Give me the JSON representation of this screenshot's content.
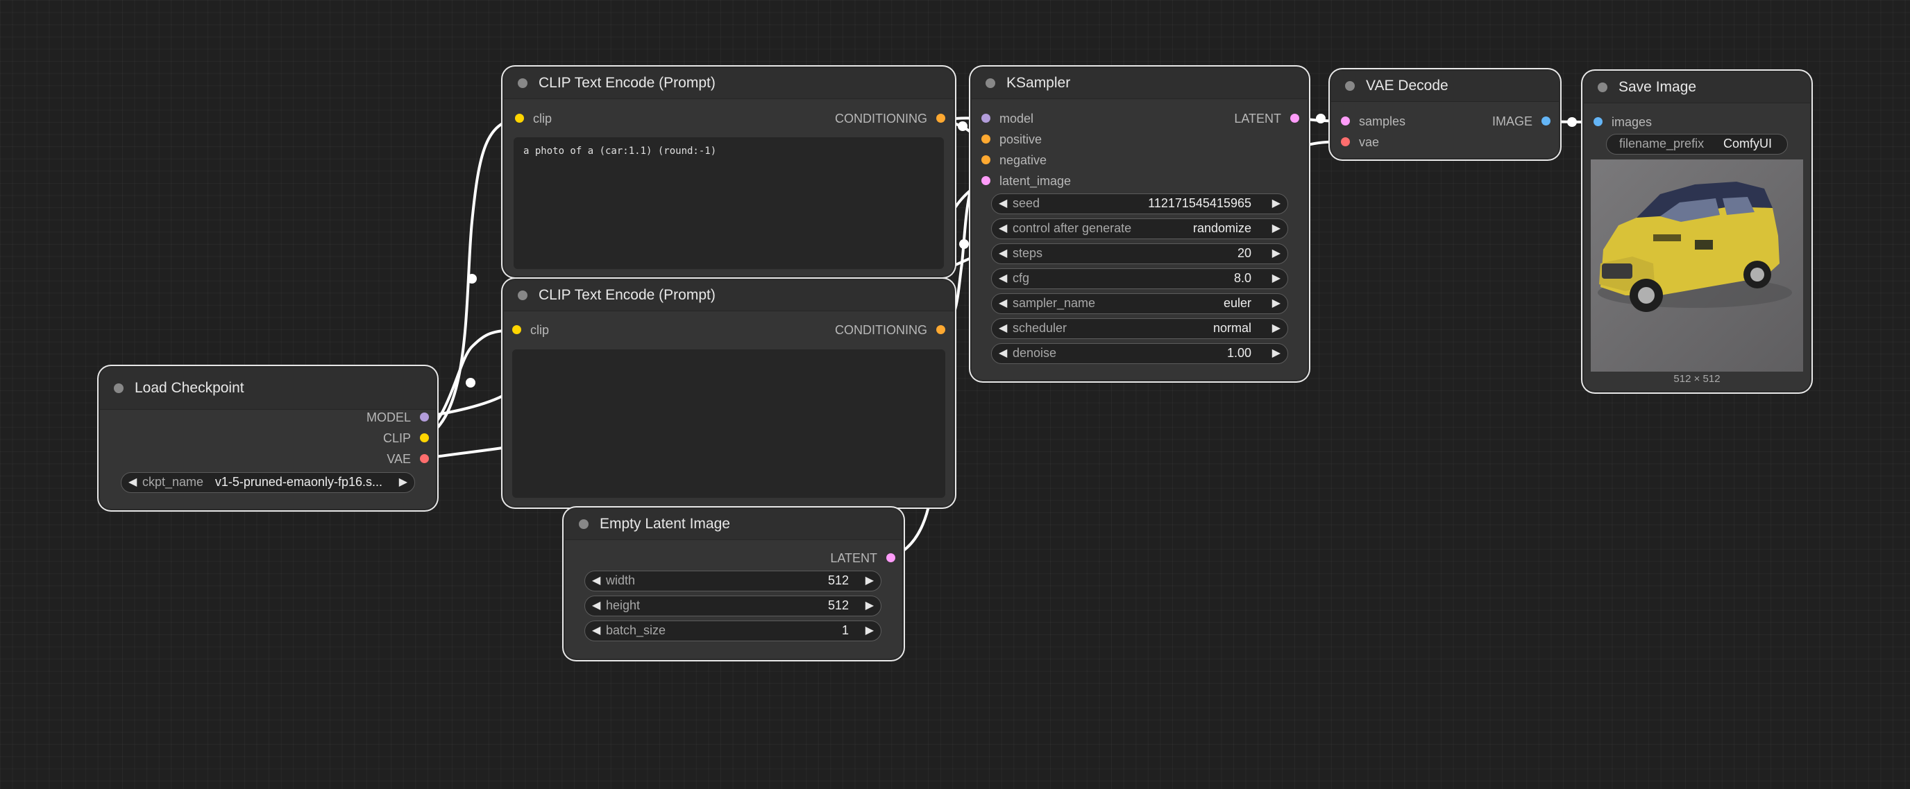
{
  "nodes": {
    "clip_text_encode_1": {
      "title": "CLIP Text Encode (Prompt)",
      "input_clip": "clip",
      "output_conditioning": "CONDITIONING",
      "prompt_text": "a photo of a (car:1.1) (round:-1)"
    },
    "clip_text_encode_2": {
      "title": "CLIP Text Encode (Prompt)",
      "input_clip": "clip",
      "output_conditioning": "CONDITIONING",
      "prompt_text": ""
    },
    "load_checkpoint": {
      "title": "Load Checkpoint",
      "output_model": "MODEL",
      "output_clip": "CLIP",
      "output_vae": "VAE",
      "ckpt_name_label": "ckpt_name",
      "ckpt_name_value": "v1-5-pruned-emaonly-fp16.s..."
    },
    "empty_latent_image": {
      "title": "Empty Latent Image",
      "output_latent": "LATENT",
      "width_label": "width",
      "width_value": "512",
      "height_label": "height",
      "height_value": "512",
      "batch_size_label": "batch_size",
      "batch_size_value": "1"
    },
    "ksampler": {
      "title": "KSampler",
      "input_model": "model",
      "input_positive": "positive",
      "input_negative": "negative",
      "input_latent_image": "latent_image",
      "output_latent": "LATENT",
      "seed_label": "seed",
      "seed_value": "112171545415965",
      "control_label": "control after generate",
      "control_value": "randomize",
      "steps_label": "steps",
      "steps_value": "20",
      "cfg_label": "cfg",
      "cfg_value": "8.0",
      "sampler_label": "sampler_name",
      "sampler_value": "euler",
      "scheduler_label": "scheduler",
      "scheduler_value": "normal",
      "denoise_label": "denoise",
      "denoise_value": "1.00"
    },
    "vae_decode": {
      "title": "VAE Decode",
      "input_samples": "samples",
      "input_vae": "vae",
      "output_image": "IMAGE"
    },
    "save_image": {
      "title": "Save Image",
      "input_images": "images",
      "filename_prefix_label": "filename_prefix",
      "filename_prefix_value": "ComfyUI",
      "image_size_caption": "512 × 512"
    }
  },
  "arrow_left": "◀",
  "arrow_right": "▶",
  "colors": {
    "canvas": "#202020",
    "node_body": "#353535",
    "node_title": "#2f2f2f",
    "wire": "#ffffff",
    "slot_model": "#b39ddb",
    "slot_clip": "#ffd500",
    "slot_vae": "#ff6e6e",
    "slot_conditioning": "#ffa931",
    "slot_latent": "#ff9cf9",
    "slot_image": "#64b5f6"
  }
}
